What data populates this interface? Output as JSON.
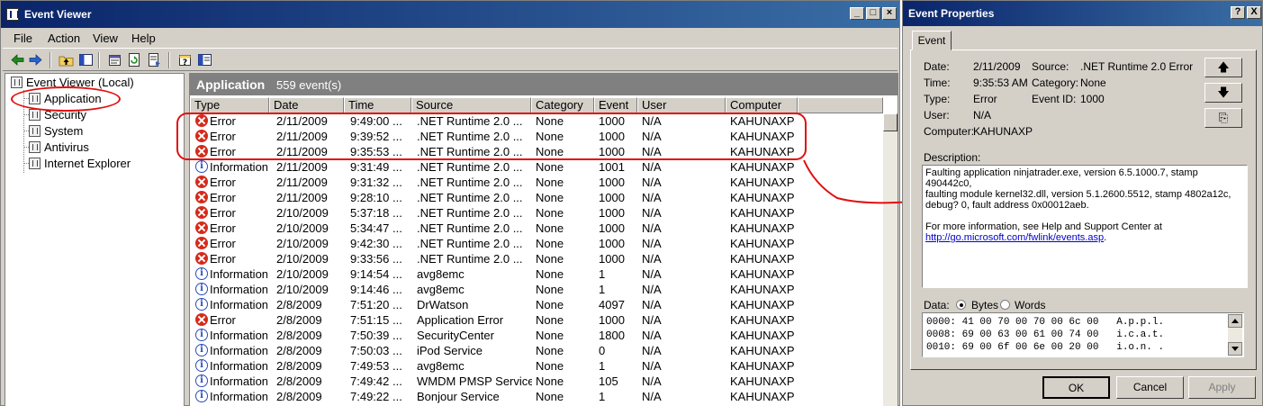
{
  "event_viewer": {
    "window_title": "Event Viewer",
    "menu": [
      "File",
      "Action",
      "View",
      "Help"
    ],
    "tree": {
      "root": "Event Viewer (Local)",
      "children": [
        "Application",
        "Security",
        "System",
        "Antivirus",
        "Internet Explorer"
      ]
    },
    "list": {
      "title": "Application",
      "count": "559 event(s)",
      "columns": [
        "Type",
        "Date",
        "Time",
        "Source",
        "Category",
        "Event",
        "User",
        "Computer"
      ],
      "rows": [
        {
          "type": "Error",
          "date": "2/11/2009",
          "time": "9:49:00 ...",
          "source": ".NET Runtime 2.0 ...",
          "category": "None",
          "event": "1000",
          "user": "N/A",
          "computer": "KAHUNAXP"
        },
        {
          "type": "Error",
          "date": "2/11/2009",
          "time": "9:39:52 ...",
          "source": ".NET Runtime 2.0 ...",
          "category": "None",
          "event": "1000",
          "user": "N/A",
          "computer": "KAHUNAXP"
        },
        {
          "type": "Error",
          "date": "2/11/2009",
          "time": "9:35:53 ...",
          "source": ".NET Runtime 2.0 ...",
          "category": "None",
          "event": "1000",
          "user": "N/A",
          "computer": "KAHUNAXP"
        },
        {
          "type": "Information",
          "date": "2/11/2009",
          "time": "9:31:49 ...",
          "source": ".NET Runtime 2.0 ...",
          "category": "None",
          "event": "1001",
          "user": "N/A",
          "computer": "KAHUNAXP"
        },
        {
          "type": "Error",
          "date": "2/11/2009",
          "time": "9:31:32 ...",
          "source": ".NET Runtime 2.0 ...",
          "category": "None",
          "event": "1000",
          "user": "N/A",
          "computer": "KAHUNAXP"
        },
        {
          "type": "Error",
          "date": "2/11/2009",
          "time": "9:28:10 ...",
          "source": ".NET Runtime 2.0 ...",
          "category": "None",
          "event": "1000",
          "user": "N/A",
          "computer": "KAHUNAXP"
        },
        {
          "type": "Error",
          "date": "2/10/2009",
          "time": "5:37:18 ...",
          "source": ".NET Runtime 2.0 ...",
          "category": "None",
          "event": "1000",
          "user": "N/A",
          "computer": "KAHUNAXP"
        },
        {
          "type": "Error",
          "date": "2/10/2009",
          "time": "5:34:47 ...",
          "source": ".NET Runtime 2.0 ...",
          "category": "None",
          "event": "1000",
          "user": "N/A",
          "computer": "KAHUNAXP"
        },
        {
          "type": "Error",
          "date": "2/10/2009",
          "time": "9:42:30 ...",
          "source": ".NET Runtime 2.0 ...",
          "category": "None",
          "event": "1000",
          "user": "N/A",
          "computer": "KAHUNAXP"
        },
        {
          "type": "Error",
          "date": "2/10/2009",
          "time": "9:33:56 ...",
          "source": ".NET Runtime 2.0 ...",
          "category": "None",
          "event": "1000",
          "user": "N/A",
          "computer": "KAHUNAXP"
        },
        {
          "type": "Information",
          "date": "2/10/2009",
          "time": "9:14:54 ...",
          "source": "avg8emc",
          "category": "None",
          "event": "1",
          "user": "N/A",
          "computer": "KAHUNAXP"
        },
        {
          "type": "Information",
          "date": "2/10/2009",
          "time": "9:14:46 ...",
          "source": "avg8emc",
          "category": "None",
          "event": "1",
          "user": "N/A",
          "computer": "KAHUNAXP"
        },
        {
          "type": "Information",
          "date": "2/8/2009",
          "time": "7:51:20 ...",
          "source": "DrWatson",
          "category": "None",
          "event": "4097",
          "user": "N/A",
          "computer": "KAHUNAXP"
        },
        {
          "type": "Error",
          "date": "2/8/2009",
          "time": "7:51:15 ...",
          "source": "Application Error",
          "category": "None",
          "event": "1000",
          "user": "N/A",
          "computer": "KAHUNAXP"
        },
        {
          "type": "Information",
          "date": "2/8/2009",
          "time": "7:50:39 ...",
          "source": "SecurityCenter",
          "category": "None",
          "event": "1800",
          "user": "N/A",
          "computer": "KAHUNAXP"
        },
        {
          "type": "Information",
          "date": "2/8/2009",
          "time": "7:50:03 ...",
          "source": "iPod Service",
          "category": "None",
          "event": "0",
          "user": "N/A",
          "computer": "KAHUNAXP"
        },
        {
          "type": "Information",
          "date": "2/8/2009",
          "time": "7:49:53 ...",
          "source": "avg8emc",
          "category": "None",
          "event": "1",
          "user": "N/A",
          "computer": "KAHUNAXP"
        },
        {
          "type": "Information",
          "date": "2/8/2009",
          "time": "7:49:42 ...",
          "source": "WMDM PMSP Service",
          "category": "None",
          "event": "105",
          "user": "N/A",
          "computer": "KAHUNAXP"
        },
        {
          "type": "Information",
          "date": "2/8/2009",
          "time": "7:49:22 ...",
          "source": "Bonjour Service",
          "category": "None",
          "event": "1",
          "user": "N/A",
          "computer": "KAHUNAXP"
        }
      ]
    }
  },
  "event_properties": {
    "window_title": "Event Properties",
    "title_buttons": [
      "?",
      "X"
    ],
    "tab": "Event",
    "labels": {
      "date": "Date:",
      "source": "Source:",
      "time": "Time:",
      "category": "Category:",
      "type": "Type:",
      "event_id": "Event ID:",
      "user": "User:",
      "computer": "Computer:",
      "description": "Description:",
      "data": "Data:",
      "bytes": "Bytes",
      "words": "Words"
    },
    "values": {
      "date": "2/11/2009",
      "source": ".NET Runtime 2.0 Error",
      "time": "9:35:53 AM",
      "category": "None",
      "type": "Error",
      "event_id": "1000",
      "user": "N/A",
      "computer": "KAHUNAXP"
    },
    "description": {
      "line1": "Faulting application ninjatrader.exe, version 6.5.1000.7, stamp 490442c0,",
      "line2": "faulting module kernel32.dll, version 5.1.2600.5512, stamp 4802a12c,",
      "line3": "debug? 0, fault address 0x00012aeb.",
      "line4": "For more information, see Help and Support Center at",
      "link": "http://go.microsoft.com/fwlink/events.asp",
      "link_suffix": "."
    },
    "data_lines": [
      "0000: 41 00 70 00 70 00 6c 00   A.p.p.l.",
      "0008: 69 00 63 00 61 00 74 00   i.c.a.t.",
      "0010: 69 00 6f 00 6e 00 20 00   i.o.n. ."
    ],
    "buttons": {
      "ok": "OK",
      "cancel": "Cancel",
      "apply": "Apply"
    },
    "nav_glyphs": {
      "up": "🡅",
      "down": "🡇",
      "copy": "⎘"
    }
  },
  "colors": {
    "annotation": "#e01010",
    "title_bar_start": "#0a246a",
    "title_bar_end": "#3a6ea5",
    "error_icon": "#d52a1a",
    "info_icon": "#2a4db8"
  }
}
